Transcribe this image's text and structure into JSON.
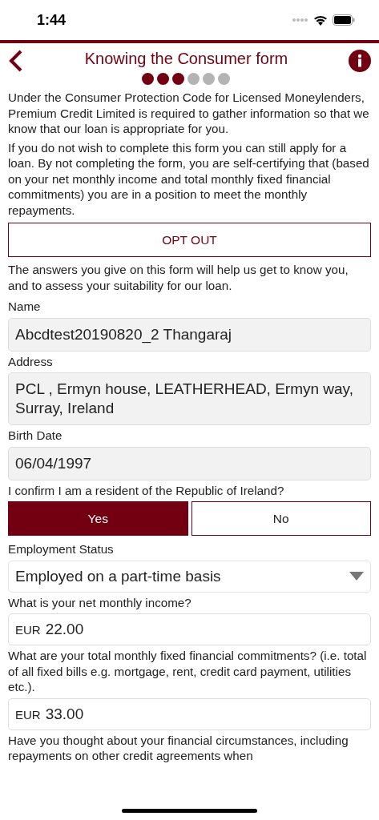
{
  "status_bar": {
    "time": "1:44"
  },
  "header": {
    "title": "Knowing the Consumer form"
  },
  "steps": [
    {
      "done": true
    },
    {
      "done": true
    },
    {
      "done": true
    },
    {
      "done": false
    },
    {
      "done": false
    },
    {
      "done": false
    }
  ],
  "intro": [
    "Under the Consumer Protection Code for Licensed Moneylenders, Premium Credit Limited is required to gather information so that we know that our loan is appropriate for you.",
    "If you do not wish to complete this form you can still apply for a loan. By not completing the form, you are self-certifying that (based on your net monthly income and total monthly fixed financial commitments) you are in a position to meet the monthly repayments."
  ],
  "opt_out_button": "OPT OUT",
  "note": "The answers you give on this form will help us get to know you, and to assess your suitability for our loan.",
  "fields": [
    {
      "kind": "text",
      "label": "Name",
      "value": "Abcdtest20190820_2 Thangaraj"
    },
    {
      "kind": "text",
      "label": "Address",
      "value": "PCL , Ermyn house, LEATHERHEAD, Ermyn way, Surray, Ireland"
    },
    {
      "kind": "text",
      "label": "Birth Date",
      "value": "06/04/1997"
    },
    {
      "kind": "choice",
      "label": "I confirm I am a resident of the Republic of Ireland?",
      "options": [
        {
          "label": "Yes",
          "selected": true
        },
        {
          "label": "No",
          "selected": false
        }
      ]
    },
    {
      "kind": "select",
      "label": "Employment Status",
      "value": "Employed on a part-time basis"
    },
    {
      "kind": "money",
      "label": "What is your net monthly income?",
      "currency": "EUR",
      "value": "22.00"
    },
    {
      "kind": "money",
      "label": "What are your total monthly fixed financial commitments? (i.e. total of all fixed bills e.g. mortgage, rent, credit card payment, utilities etc.).",
      "currency": "EUR",
      "value": "33.00"
    },
    {
      "kind": "question",
      "label": "Have you thought about your financial circumstances, including repayments on other credit agreements when"
    }
  ]
}
